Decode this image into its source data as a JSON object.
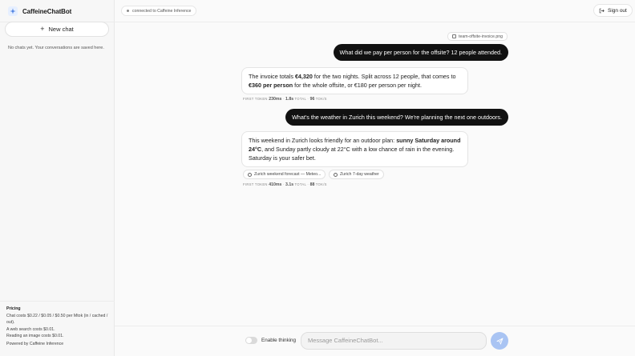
{
  "app": {
    "name": "CaffeineChatBot"
  },
  "sidebar": {
    "new_chat_label": "New chat",
    "empty_text": "No chats yet. Your conversations are saved here.",
    "pricing": {
      "title": "Pricing",
      "lines": [
        "Chat costs $0.22 / $0.05 / $0.50 per Mtok (in / cached / out).",
        "A web search costs $0.01.",
        "Reading an image costs $0.01."
      ],
      "powered_by": "Powered by Caffeine Inference"
    }
  },
  "header": {
    "status": "connected to Caffeine Inference",
    "sign_out_label": "Sign out"
  },
  "conversation": {
    "attachment": "team-offsite-invoice.png",
    "messages": [
      {
        "user": "What did we pay per person for the offsite? 12 people attended.",
        "bot": {
          "p1": "The invoice totals ",
          "b1": "€4,320",
          "p2": " for the two nights. Split across 12 people, that comes to ",
          "b2": "€360 per person",
          "p3": " for the whole offsite, or €180 per person per night."
        },
        "meta": {
          "first_token_label": "first token",
          "first_token_value": "230ms",
          "total_value": "1.8s",
          "total_label": "total",
          "rate_value": "96",
          "rate_label": "tok/s"
        }
      },
      {
        "user": "What's the weather in Zurich this weekend? We're planning the next one outdoors.",
        "bot": {
          "p1": "This weekend in Zurich looks friendly for an outdoor plan: ",
          "b1": "sunny Saturday around 24°C",
          "p2": ", and Sunday partly cloudy at 22°C with a low chance of rain in the evening. Saturday is your safer bet."
        },
        "sources": [
          "Zurich weekend forecast — Meteo...",
          "Zurich 7-day weather"
        ],
        "meta": {
          "first_token_label": "first token",
          "first_token_value": "410ms",
          "total_value": "3.1s",
          "total_label": "total",
          "rate_value": "88",
          "rate_label": "tok/s"
        }
      }
    ]
  },
  "composer": {
    "thinking_label": "Enable thinking",
    "thinking_enabled": false,
    "input_value": "",
    "placeholder": "Message CaffeineChatBot..."
  },
  "colors": {
    "accent": "#a9c4f3",
    "user_bubble": "#111111",
    "brand_icon": "#4a7fe0"
  }
}
